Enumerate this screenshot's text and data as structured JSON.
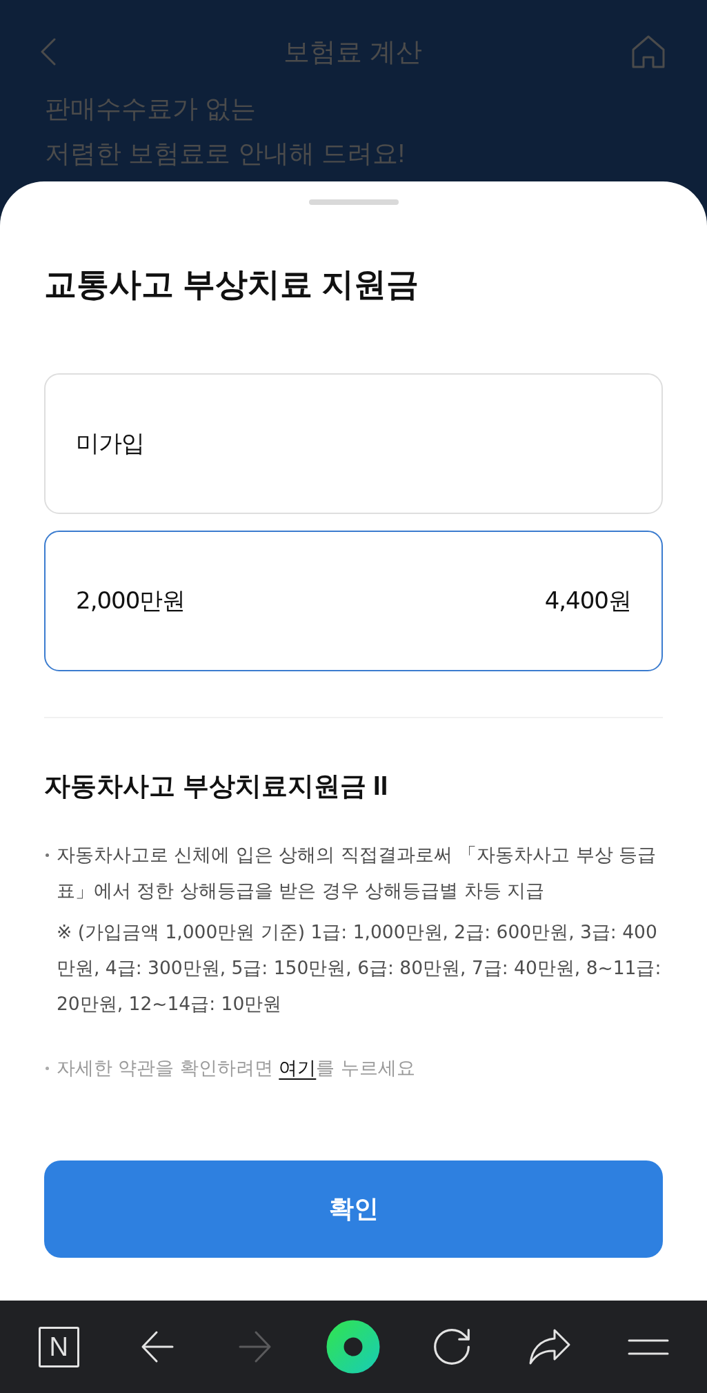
{
  "header": {
    "title": "보험료 계산",
    "subtitle_lines": [
      "판매수수료가 없는",
      "저렴한 보험료로 안내해 드려요!"
    ]
  },
  "sheet": {
    "title": "교통사고 부상치료 지원금",
    "options": [
      {
        "label": "미가입",
        "selected": false
      },
      {
        "label": "2,000만원",
        "price": "4,400원",
        "selected": true
      }
    ],
    "section": {
      "heading": "자동차사고 부상치료지원금 II",
      "paragraphs": [
        {
          "kind": "bullet",
          "text": "자동차사고로 신체에 입은 상해의 직접결과로써 「자동차사고 부상 등급표」에서 정한 상해등급을 받은 경우 상해등급별 차등 지급"
        },
        {
          "kind": "note",
          "text": "※ (가입금액 1,000만원 기준) 1급: 1,000만원, 2급: 600만원, 3급: 400만원, 4급: 300만원, 5급: 150만원, 6급: 80만원, 7급: 40만원, 8~11급: 20만원, 12~14급: 10만원"
        }
      ],
      "terms": {
        "before": "자세한 약관을 확인하려면",
        "link": "여기",
        "after": "를 누르세요"
      }
    },
    "confirm_button": "확인"
  },
  "browser_toolbar": [
    {
      "kind": "logo",
      "label": "N",
      "disabled": false
    },
    {
      "kind": "back",
      "disabled": false
    },
    {
      "kind": "forward",
      "disabled": true
    },
    {
      "kind": "ring",
      "disabled": false
    },
    {
      "kind": "reload",
      "disabled": false
    },
    {
      "kind": "share",
      "disabled": false
    },
    {
      "kind": "menu",
      "disabled": false
    }
  ]
}
